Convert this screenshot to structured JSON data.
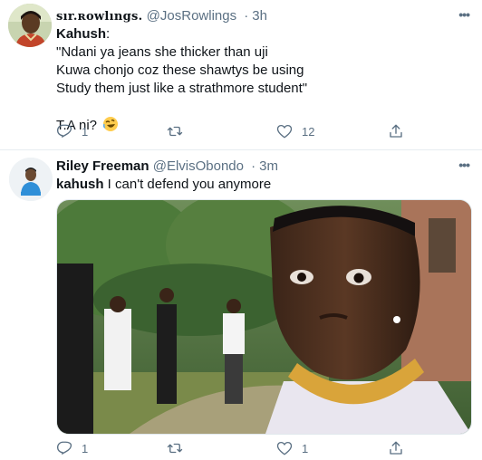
{
  "tweets": [
    {
      "name": "sır.ʀowlıngs.",
      "handle": "@JosRowlings",
      "separator": "·",
      "time": "3h",
      "body_author": "Kahush",
      "body_lines": [
        "\"Ndani ya jeans she thicker than uji",
        "Kuwa chonjo coz these shawtys be using",
        "Study them just like a strathmore student\"",
        "",
        "T.A ni? "
      ],
      "emoji": "rolling-on-floor-laughing",
      "actions": {
        "replies": "1",
        "retweets": "",
        "likes": "12"
      }
    },
    {
      "name": "Riley Freeman",
      "handle": "@ElvisObondo",
      "separator": "·",
      "time": "3m",
      "mention": "kahush",
      "text": " I can't defend you anymore",
      "media": "photo-man-gold-chain-meme",
      "actions": {
        "replies": "1",
        "retweets": "",
        "likes": "1"
      }
    }
  ],
  "icons": {
    "reply": "reply-icon",
    "retweet": "retweet-icon",
    "like": "heart-icon",
    "share": "share-icon",
    "more": "more-icon"
  },
  "colors": {
    "muted": "#5b7083",
    "text": "#0f1419",
    "divider": "#e6ecf0"
  }
}
